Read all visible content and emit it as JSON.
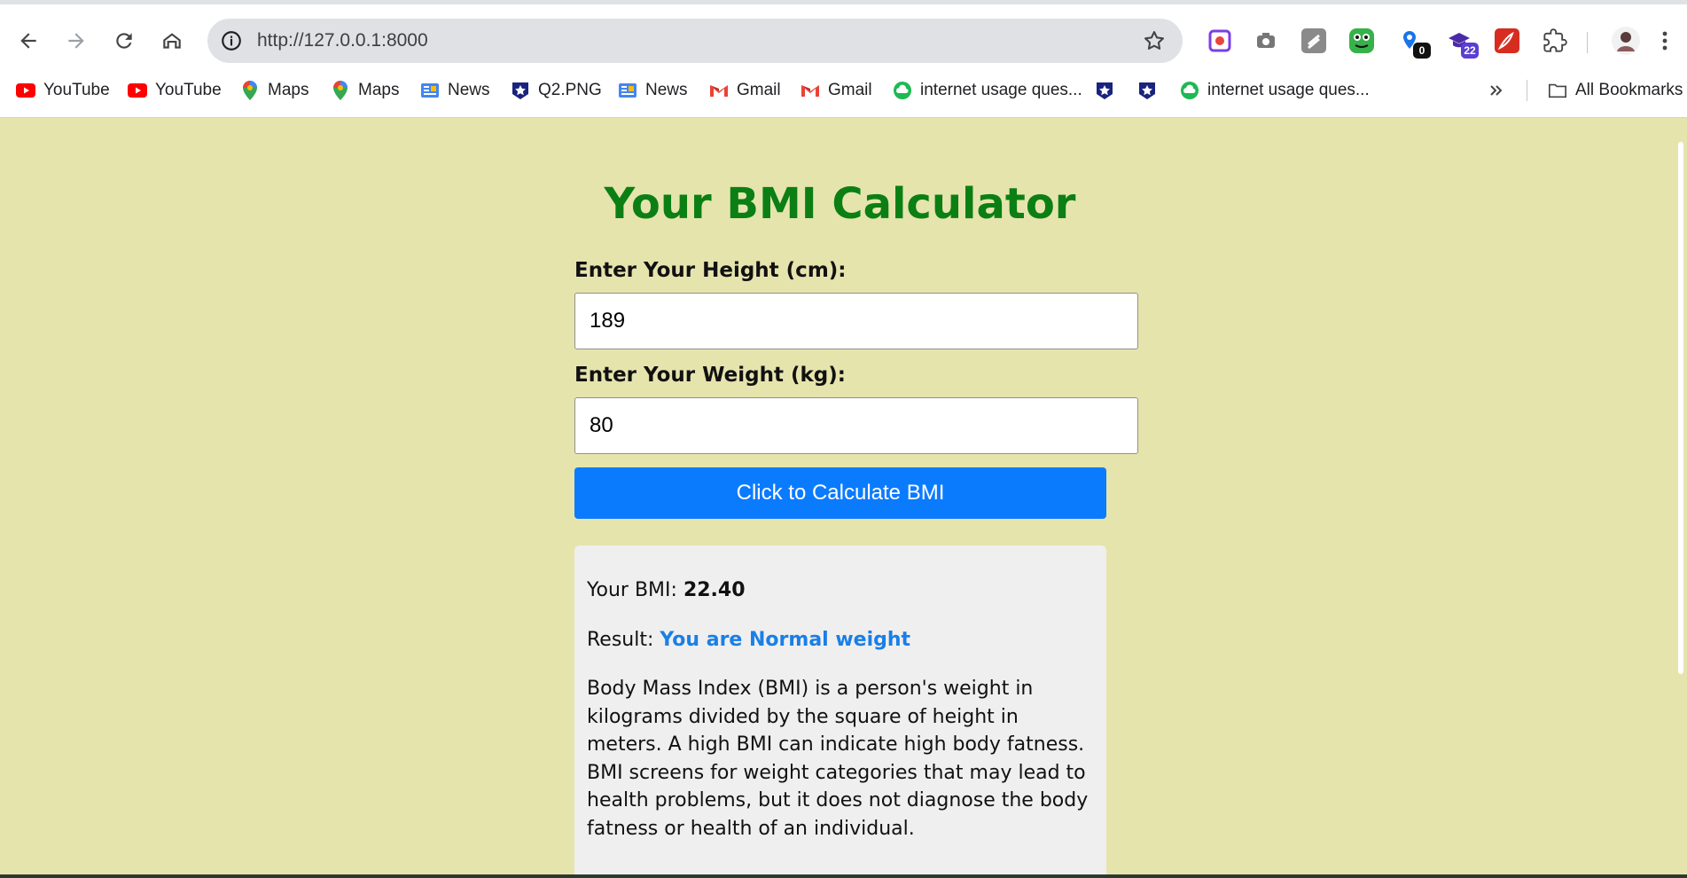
{
  "browser": {
    "url": "http://127.0.0.1:8000",
    "extension_badges": {
      "ext_blue_count": "0",
      "ext_purple_count": "22"
    },
    "bookmarks": [
      {
        "label": "YouTube",
        "icon": "youtube-icon"
      },
      {
        "label": "YouTube",
        "icon": "youtube-icon"
      },
      {
        "label": "Maps",
        "icon": "maps-icon"
      },
      {
        "label": "Maps",
        "icon": "maps-icon"
      },
      {
        "label": "News",
        "icon": "google-news-icon"
      },
      {
        "label": "Q2.PNG",
        "icon": "star-shield-icon"
      },
      {
        "label": "News",
        "icon": "google-news-icon"
      },
      {
        "label": "Gmail",
        "icon": "gmail-icon"
      },
      {
        "label": "Gmail",
        "icon": "gmail-icon"
      },
      {
        "label": "internet usage ques...",
        "icon": "green-cloud-icon"
      },
      {
        "label": "",
        "icon": "star-shield-icon"
      },
      {
        "label": "",
        "icon": "star-shield-icon"
      },
      {
        "label": "internet usage ques...",
        "icon": "green-cloud-icon"
      }
    ],
    "all_bookmarks_label": "All Bookmarks"
  },
  "page": {
    "title": "Your BMI Calculator",
    "height_label": "Enter Your Height (cm):",
    "height_value": "189",
    "weight_label": "Enter Your Weight (kg):",
    "weight_value": "80",
    "button_label": "Click to Calculate BMI",
    "result": {
      "bmi_prefix": "Your BMI: ",
      "bmi_value": "22.40",
      "result_prefix": "Result: ",
      "result_value": "You are Normal weight",
      "description": "Body Mass Index (BMI) is a person's weight in kilograms divided by the square of height in meters. A high BMI can indicate high body fatness. BMI screens for weight categories that may lead to health problems, but it does not diagnose the body fatness or health of an individual."
    }
  },
  "colors": {
    "page_background": "#e6e4ad",
    "title": "#0b7f14",
    "button": "#0b7bfe",
    "result_status": "#1a7fe6",
    "result_panel": "#efefef"
  }
}
